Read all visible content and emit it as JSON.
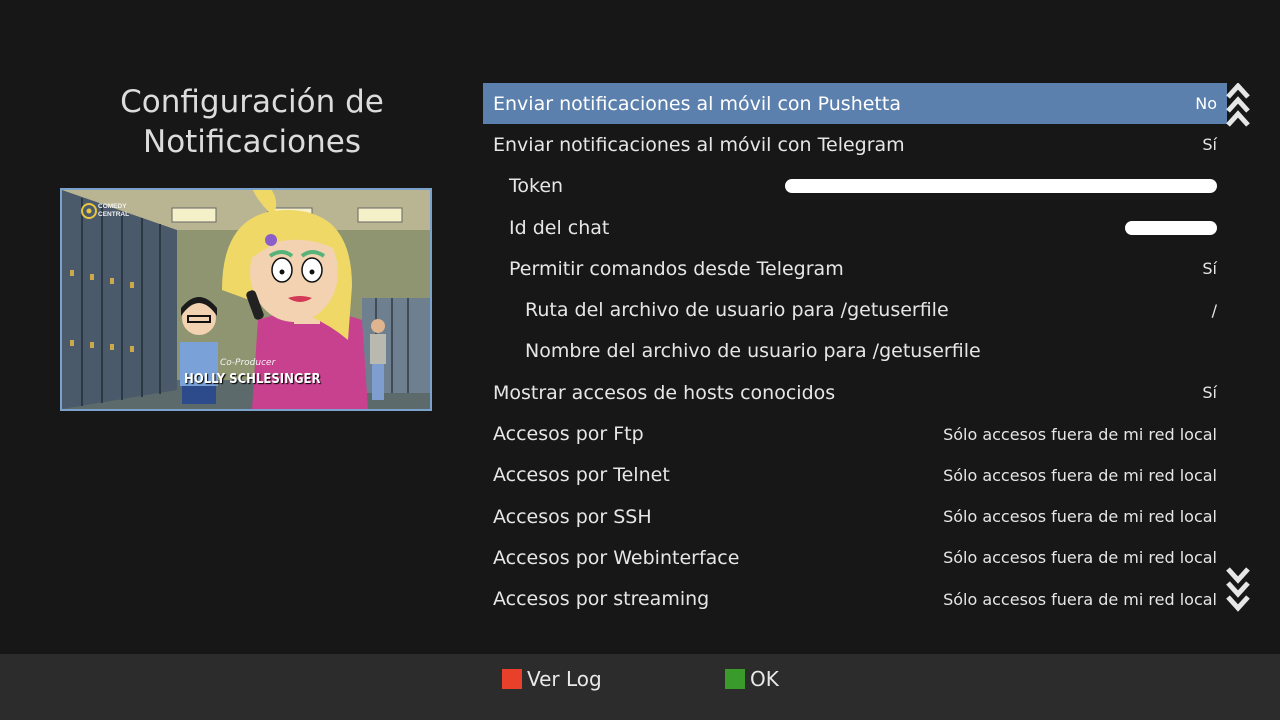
{
  "screen": {
    "title_line1": "Configuración de",
    "title_line2": "Notificaciones"
  },
  "preview": {
    "channel_logo_text": "COMEDY CENTRAL",
    "credit_role": "Co-Producer",
    "credit_name": "HOLLY SCHLESINGER"
  },
  "menu": {
    "items": [
      {
        "label": "Enviar notificaciones al móvil con Pushetta",
        "value": "No",
        "selected": true
      },
      {
        "label": "Enviar notificaciones al móvil con Telegram",
        "value": "Sí"
      },
      {
        "label": "Token",
        "value": ""
      },
      {
        "label": "Id del chat",
        "value": ""
      },
      {
        "label": "Permitir comandos desde Telegram",
        "value": "Sí"
      },
      {
        "label": "Ruta del archivo de usuario para /getuserfile",
        "value": "/"
      },
      {
        "label": "Nombre del archivo de usuario para /getuserfile",
        "value": ""
      },
      {
        "label": "Mostrar accesos de hosts conocidos",
        "value": "Sí"
      },
      {
        "label": "Accesos por Ftp",
        "value": "Sólo accesos fuera de mi red local"
      },
      {
        "label": "Accesos por Telnet",
        "value": "Sólo accesos fuera de mi red local"
      },
      {
        "label": "Accesos por SSH",
        "value": "Sólo accesos fuera de mi red local"
      },
      {
        "label": "Accesos por Webinterface",
        "value": "Sólo accesos fuera de mi red local"
      },
      {
        "label": "Accesos por streaming",
        "value": "Sólo accesos fuera de mi red local"
      }
    ]
  },
  "icons": {
    "scroll_up": "double-chevron-up-icon",
    "scroll_down": "double-chevron-down-icon"
  },
  "footer": {
    "red_button_label": "Ver Log",
    "green_button_label": "OK",
    "red_color": "#e8402a",
    "green_color": "#3a9a2a"
  },
  "colors": {
    "background": "#171717",
    "selected_row": "#5b80ad",
    "footer_bar": "#2c2c2c"
  }
}
